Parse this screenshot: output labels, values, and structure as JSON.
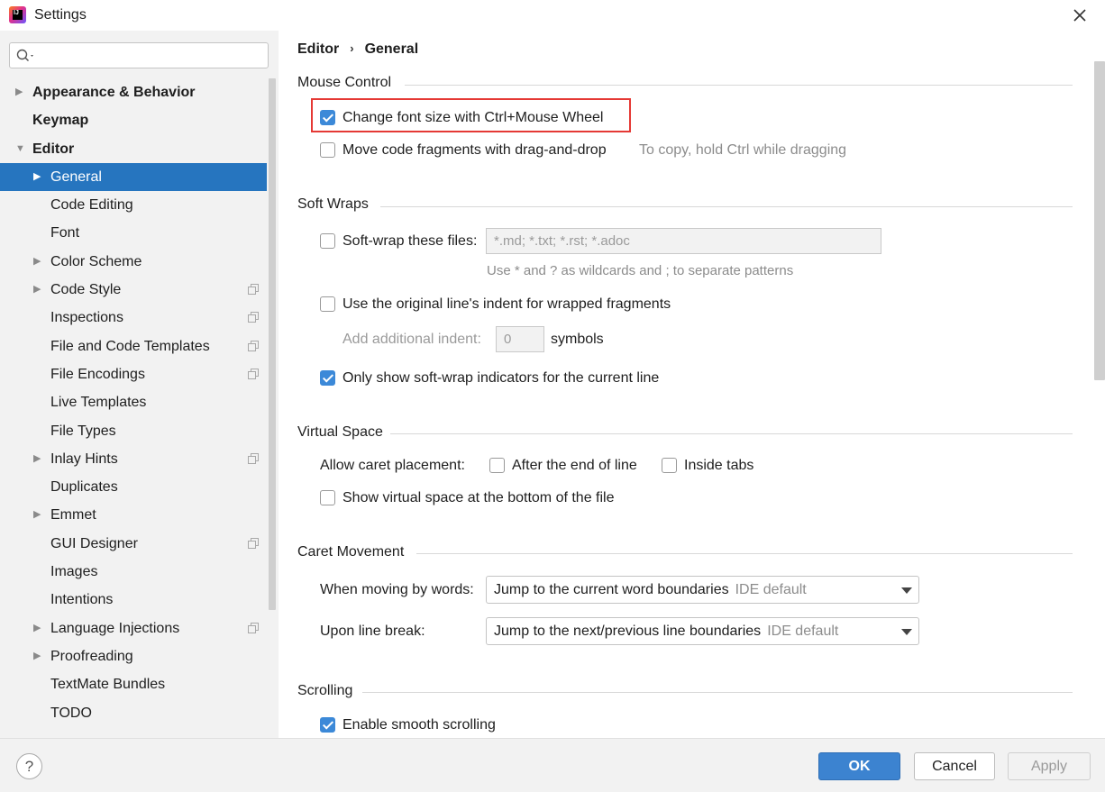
{
  "window": {
    "title": "Settings",
    "app_icon_text": "IJ"
  },
  "search": {
    "placeholder": ""
  },
  "tree": [
    {
      "label": "Appearance & Behavior",
      "level": 0,
      "arrow": "▶",
      "copy": false,
      "selected": false
    },
    {
      "label": "Keymap",
      "level": 0,
      "arrow": "",
      "copy": false,
      "selected": false
    },
    {
      "label": "Editor",
      "level": 0,
      "arrow": "▼",
      "copy": false,
      "selected": false
    },
    {
      "label": "General",
      "level": 1,
      "arrow": "▶",
      "copy": false,
      "selected": true
    },
    {
      "label": "Code Editing",
      "level": 1,
      "arrow": "",
      "copy": false,
      "selected": false
    },
    {
      "label": "Font",
      "level": 1,
      "arrow": "",
      "copy": false,
      "selected": false
    },
    {
      "label": "Color Scheme",
      "level": 1,
      "arrow": "▶",
      "copy": false,
      "selected": false
    },
    {
      "label": "Code Style",
      "level": 1,
      "arrow": "▶",
      "copy": true,
      "selected": false
    },
    {
      "label": "Inspections",
      "level": 1,
      "arrow": "",
      "copy": true,
      "selected": false
    },
    {
      "label": "File and Code Templates",
      "level": 1,
      "arrow": "",
      "copy": true,
      "selected": false
    },
    {
      "label": "File Encodings",
      "level": 1,
      "arrow": "",
      "copy": true,
      "selected": false
    },
    {
      "label": "Live Templates",
      "level": 1,
      "arrow": "",
      "copy": false,
      "selected": false
    },
    {
      "label": "File Types",
      "level": 1,
      "arrow": "",
      "copy": false,
      "selected": false
    },
    {
      "label": "Inlay Hints",
      "level": 1,
      "arrow": "▶",
      "copy": true,
      "selected": false
    },
    {
      "label": "Duplicates",
      "level": 1,
      "arrow": "",
      "copy": false,
      "selected": false
    },
    {
      "label": "Emmet",
      "level": 1,
      "arrow": "▶",
      "copy": false,
      "selected": false
    },
    {
      "label": "GUI Designer",
      "level": 1,
      "arrow": "",
      "copy": true,
      "selected": false
    },
    {
      "label": "Images",
      "level": 1,
      "arrow": "",
      "copy": false,
      "selected": false
    },
    {
      "label": "Intentions",
      "level": 1,
      "arrow": "",
      "copy": false,
      "selected": false
    },
    {
      "label": "Language Injections",
      "level": 1,
      "arrow": "▶",
      "copy": true,
      "selected": false
    },
    {
      "label": "Proofreading",
      "level": 1,
      "arrow": "▶",
      "copy": false,
      "selected": false
    },
    {
      "label": "TextMate Bundles",
      "level": 1,
      "arrow": "",
      "copy": false,
      "selected": false
    },
    {
      "label": "TODO",
      "level": 1,
      "arrow": "",
      "copy": false,
      "selected": false
    }
  ],
  "breadcrumb": {
    "parent": "Editor",
    "separator": "›",
    "current": "General"
  },
  "mouse_control": {
    "title": "Mouse Control",
    "change_font_label": "Change font size with Ctrl+Mouse Wheel",
    "change_font_checked": true,
    "drag_drop_label": "Move code fragments with drag-and-drop",
    "drag_drop_checked": false,
    "drag_drop_hint": "To copy, hold Ctrl while dragging"
  },
  "soft_wraps": {
    "title": "Soft Wraps",
    "soft_wrap_label": "Soft-wrap these files:",
    "soft_wrap_checked": false,
    "soft_wrap_value": "*.md; *.txt; *.rst; *.adoc",
    "soft_wrap_hint": "Use * and ? as wildcards and ; to separate patterns",
    "original_indent_label": "Use the original line's indent for wrapped fragments",
    "original_indent_checked": false,
    "additional_indent_label": "Add additional indent:",
    "additional_indent_value": "0",
    "symbols_label": "symbols",
    "indicators_label": "Only show soft-wrap indicators for the current line",
    "indicators_checked": true
  },
  "virtual_space": {
    "title": "Virtual Space",
    "caret_label": "Allow caret placement:",
    "after_end_label": "After the end of line",
    "after_end_checked": false,
    "inside_tabs_label": "Inside tabs",
    "inside_tabs_checked": false,
    "show_bottom_label": "Show virtual space at the bottom of the file",
    "show_bottom_checked": false
  },
  "caret_movement": {
    "title": "Caret Movement",
    "words_label": "When moving by words:",
    "words_value": "Jump to the current word boundaries",
    "words_hint": "IDE default",
    "line_break_label": "Upon line break:",
    "line_break_value": "Jump to the next/previous line boundaries",
    "line_break_hint": "IDE default"
  },
  "scrolling": {
    "title": "Scrolling",
    "smooth_label": "Enable smooth scrolling",
    "smooth_checked": true
  },
  "footer": {
    "help": "?",
    "ok": "OK",
    "cancel": "Cancel",
    "apply": "Apply"
  }
}
